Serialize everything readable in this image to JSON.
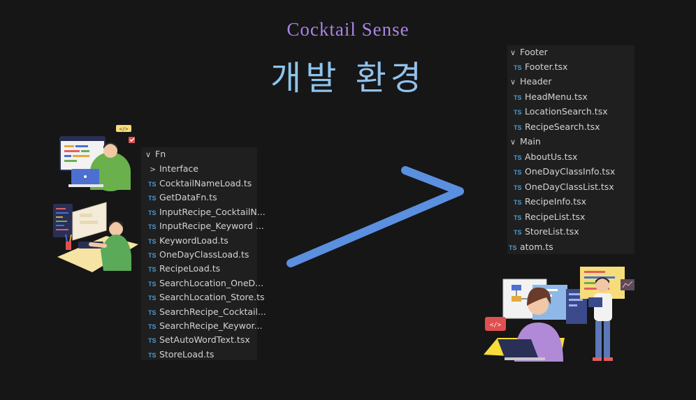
{
  "header": {
    "brand": "Cocktail Sense",
    "title": "개발 환경"
  },
  "left_tree": {
    "folder": "Fn",
    "subfolder": "Interface",
    "files": [
      "CocktailNameLoad.ts",
      "GetDataFn.ts",
      "InputRecipe_CocktailN...",
      "InputRecipe_Keyword ...",
      "KeywordLoad.ts",
      "OneDayClassLoad.ts",
      "RecipeLoad.ts",
      "SearchLocation_OneD...",
      "SearchLocation_Store.ts",
      "SearchRecipe_Cocktail...",
      "SearchRecipe_Keywor...",
      "SetAutoWordText.tsx",
      "StoreLoad.ts"
    ]
  },
  "right_tree": {
    "groups": [
      {
        "folder": "Footer",
        "files": [
          "Footer.tsx"
        ]
      },
      {
        "folder": "Header",
        "files": [
          "HeadMenu.tsx",
          "LocationSearch.tsx",
          "RecipeSearch.tsx"
        ]
      },
      {
        "folder": "Main",
        "files": [
          "AboutUs.tsx",
          "OneDayClassInfo.tsx",
          "OneDayClassList.tsx",
          "RecipeInfo.tsx",
          "RecipeList.tsx",
          "StoreList.tsx"
        ]
      }
    ],
    "root_file": "atom.ts"
  },
  "file_badge": "TS",
  "illustration_labels": {
    "code_tag": "</>",
    "code_tag_red": "</>"
  },
  "colors": {
    "background": "#161616",
    "panel": "#1f1f1f",
    "arrow": "#5b8fe0",
    "ts_badge": "#4a9bd6"
  }
}
